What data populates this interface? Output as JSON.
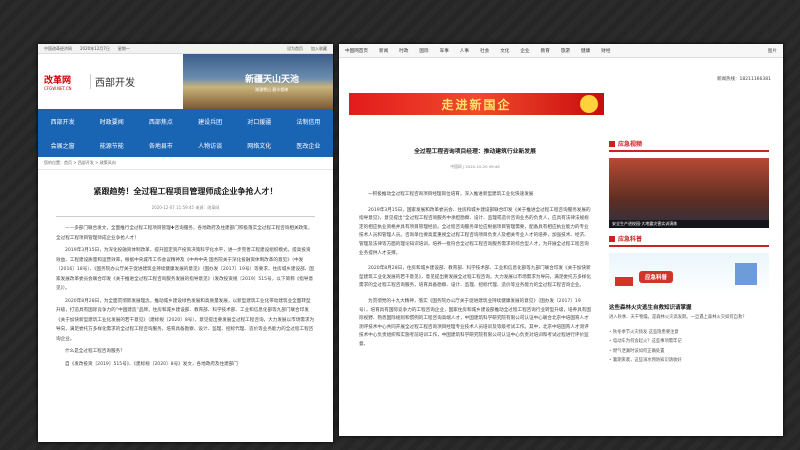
{
  "left": {
    "topbar": {
      "site": "中国改革经济网",
      "date": "2020年12月7日",
      "weekday": "星期一",
      "set_home": "设为首页",
      "favorite": "加入收藏"
    },
    "logo": {
      "cn": "改革网",
      "en": "CFGW.NET.CN"
    },
    "section": "西部开发",
    "banner": {
      "title": "新疆天山天池",
      "subtitle": "湖漫雪山 碧水相映"
    },
    "nav": [
      "西部开发",
      "时政要闻",
      "西部焦点",
      "建设兵团",
      "对口援疆",
      "法制信用",
      "会展之窗",
      "能源节能",
      "各地县市",
      "人物访谈",
      "网络文化",
      "医改企业"
    ],
    "breadcrumb": "您的位置：首页 > 西部开发 > 政策风向",
    "title": "紧跟趋势！全过程工程项目管理师成企业争抢人才！",
    "meta": "2020-12-07 11:59:45    来源：改革网",
    "paragraphs": [
      "——多部门联合发文，全面推行全过程工程项目管理✚咨询服务，各地政府及住建部门积极落实全过程工程咨询相关政策，全过程工程项目管理师成企业争抢人才！",
      "2019年3月15日，为深化投融资体制改革，提升固定资产投资决策科学化水平，进一步完善工程建设组织模式，提高投资效益、工程建设质量和运营效率，根据中央城市工作会议精神及《中共中央 国务院关于深化投融资体制改革的意见》（中发〔2016〕18号）、《国务院办公厅关于促进建筑业持续健康发展的意见》（国办发〔2017〕19号）等要求，住房城乡建设部、国家发展改革委员会联合印发《关于推进全过程工程咨询服务发展的指导意见》（发改投资规〔2019〕515号，以下简称《指导意见》）。",
      "2020年8月28日，为全面贯彻新发展理念，推动城乡建设绿色发展和高质量发展，以新型建筑工业化带动建筑业全面转型升级，打造具有国际竞争力的“中国建造”品牌，住房和城乡建设部、教育部、科学技术部、工业和信息化部等九部门联合印发《关于加快新型建筑工业化发展的若干意见》（建标规〔2020〕8号），意见提出要发展全过程工程咨询，大力发展以市场需求为导向，满足委托方多样化需求的全过程工程咨询服务，培育具备勘察、设计、监理、招标代理、造价等业务能力的全过程工程咨询企业。"
    ],
    "question": "什么是全过程工程咨询服务？",
    "last": "自《发改投资〔2019〕515号》、《建标规〔2020〕8号》发文，各地政府及住建部门"
  },
  "right": {
    "nav": [
      "中国网首页",
      "新闻",
      "时政",
      "国际",
      "军事",
      "人事",
      "社会",
      "文化",
      "企业",
      "教育",
      "旅游",
      "健康",
      "财经",
      "图片"
    ],
    "hotline": "新闻热线：18211166381",
    "banner": "走进新国企",
    "title": "全过程工程咨询项目经理：推动建筑行业新发展",
    "meta": "中国网  |  2020-10-20 09:46",
    "paragraphs": [
      "一积极推动全过程工程咨询项目经理岗位培育，深入推进新型建筑工业化快速发展",
      "2019年3月15日，国家发展和改革委员会、住房和城乡建设部联合印发《关于推进全过程工程咨询服务发展的指导意见》，意见提出“全过程工程咨询服务中承担勘察、设计、监理或造价咨询业务的负责人，应具有法律法规规定的相应执业资格并具有项目管理经验。全过程咨询服务单位应根据项目管理需要，配备具有相应执业能力的专业技术人员和管理人员。咨询单位要高度重视全过程工程咨询项目负责人及相关专业人才的培养，加强技术、经济、管理及法律等方面的理论知识培训，培养一批符合全过程工程咨询服务需求的综合型人才，为开展全过程工程咨询业务提供人才支撑。",
      "2020年8月28日，住房和城乡建设部、教育部、科学技术部、工业和信息化部等九部门联合印发《关于加快新型建筑工业化发展的若干意见》，意见提出要发展全过程工程咨询，大力发展以市场需求为导向，满足委托方多样化需求的全过程工程咨询服务，培育具备勘察、设计、监理、招标代理、造价等业务能力的全过程工程咨询企业。",
      "为贯彻党的十九大精神，落实《国务院办公厅关于促进建筑业持续健康发展的意见》（国办发〔2017〕19号），培育具有国际竞争力的工程咨询企业，国家住房和城乡建设部推动全过程工程咨询行业转型升级，培养具有国际视野、熟悉国际规则和惯例的工程咨询高端人才，中国建筑科学研究院有限公司认证中心联合北京中培国育人才测评技术中心共同开展全过程工程咨询项目经理专业技术人员培训及等级考试工作。其中，北京中培国育人才测评技术中心负责组织和实施考前培训工作，中国建筑科学研究院有限公司认证中心负责对培训和考试过程进行评价监督。"
    ],
    "sidebar": {
      "video_heading": "应急视频",
      "video_caption": "安全生产进校园·大地震灾害实训演练",
      "science_heading": "应急科普",
      "science_badge": "应急科普",
      "article_title": "这些森林火灾逃生自救知识请掌握",
      "article_desc": "进入秋季、天干物燥，是森林火灾高发期。一旦遇上森林火灾如何自救？",
      "links": [
        "秋冬季节火灾频发 这些隐患要注意",
        "电动车为何会起火？这些事项需牢记",
        "燃气泄漏时该如何正确处置",
        "暑期来袭，这些溺水预防知识请收好"
      ]
    }
  }
}
